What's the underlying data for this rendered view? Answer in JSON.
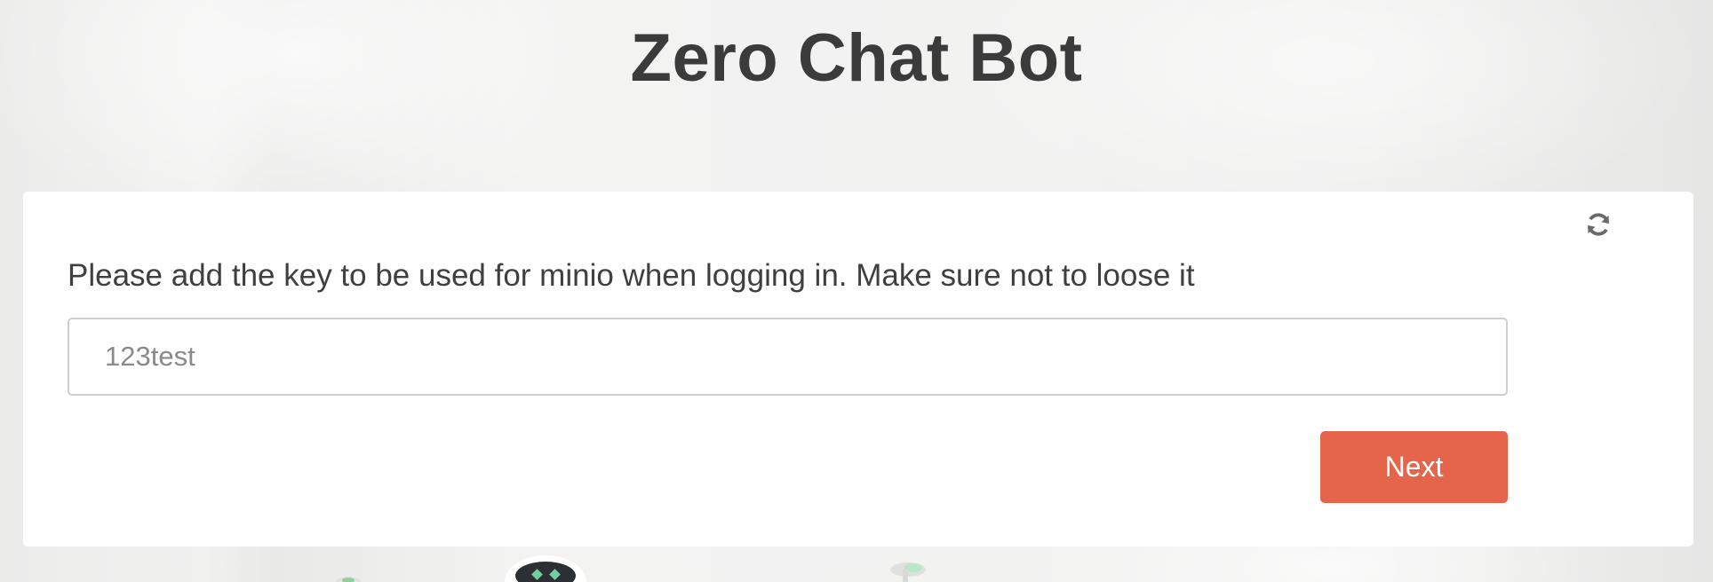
{
  "header": {
    "title": "Zero Chat Bot"
  },
  "form": {
    "prompt": "Please add the key to be used for minio when logging in. Make sure not to loose it",
    "key_value": "123test",
    "next_label": "Next",
    "refresh_icon": "refresh-icon"
  },
  "colors": {
    "accent": "#e4654a",
    "title_text": "#3b3b3b",
    "card_background": "#ffffff"
  }
}
